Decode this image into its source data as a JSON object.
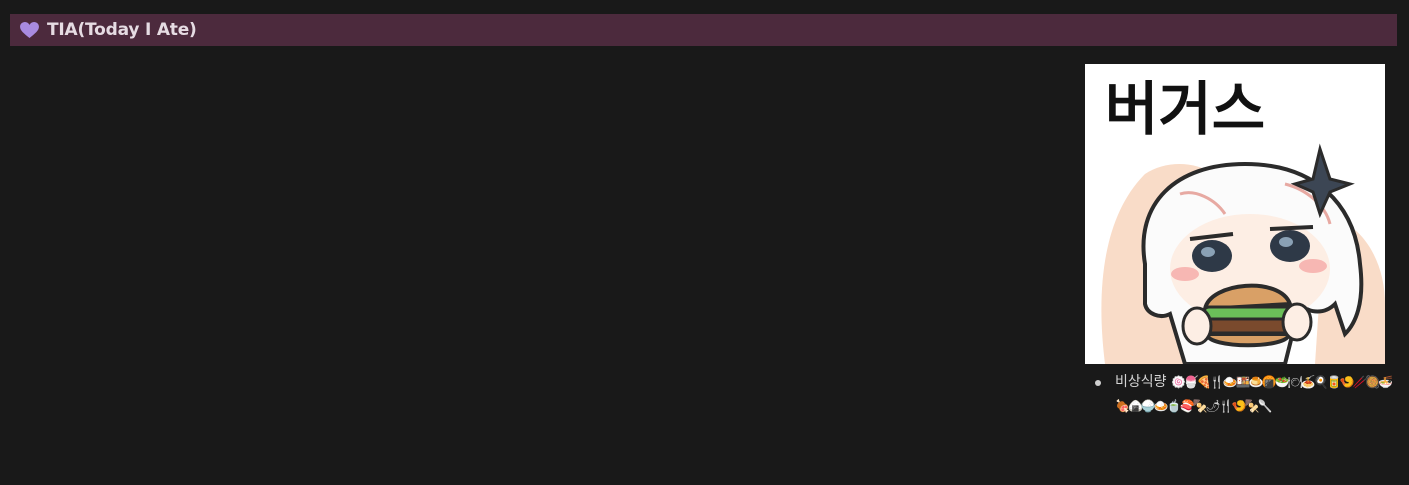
{
  "header": {
    "title": "TIA(Today I Ate)",
    "icon": "purple-heart-icon",
    "background": "#4c2a3d",
    "heart_color": "#a98be0"
  },
  "sticker": {
    "text": "버거스",
    "icon": "burger-sticker"
  },
  "list": {
    "item_label": "비상식량",
    "emojis": "🍥🍧🍕🍴🍛🍱🍮🍘🥗🍽🍝🍳🥫🍤🥢🥘🍜🍖🍙🍚🍛🍵🍣🍢🌶🍴🍤🍢🥄"
  }
}
